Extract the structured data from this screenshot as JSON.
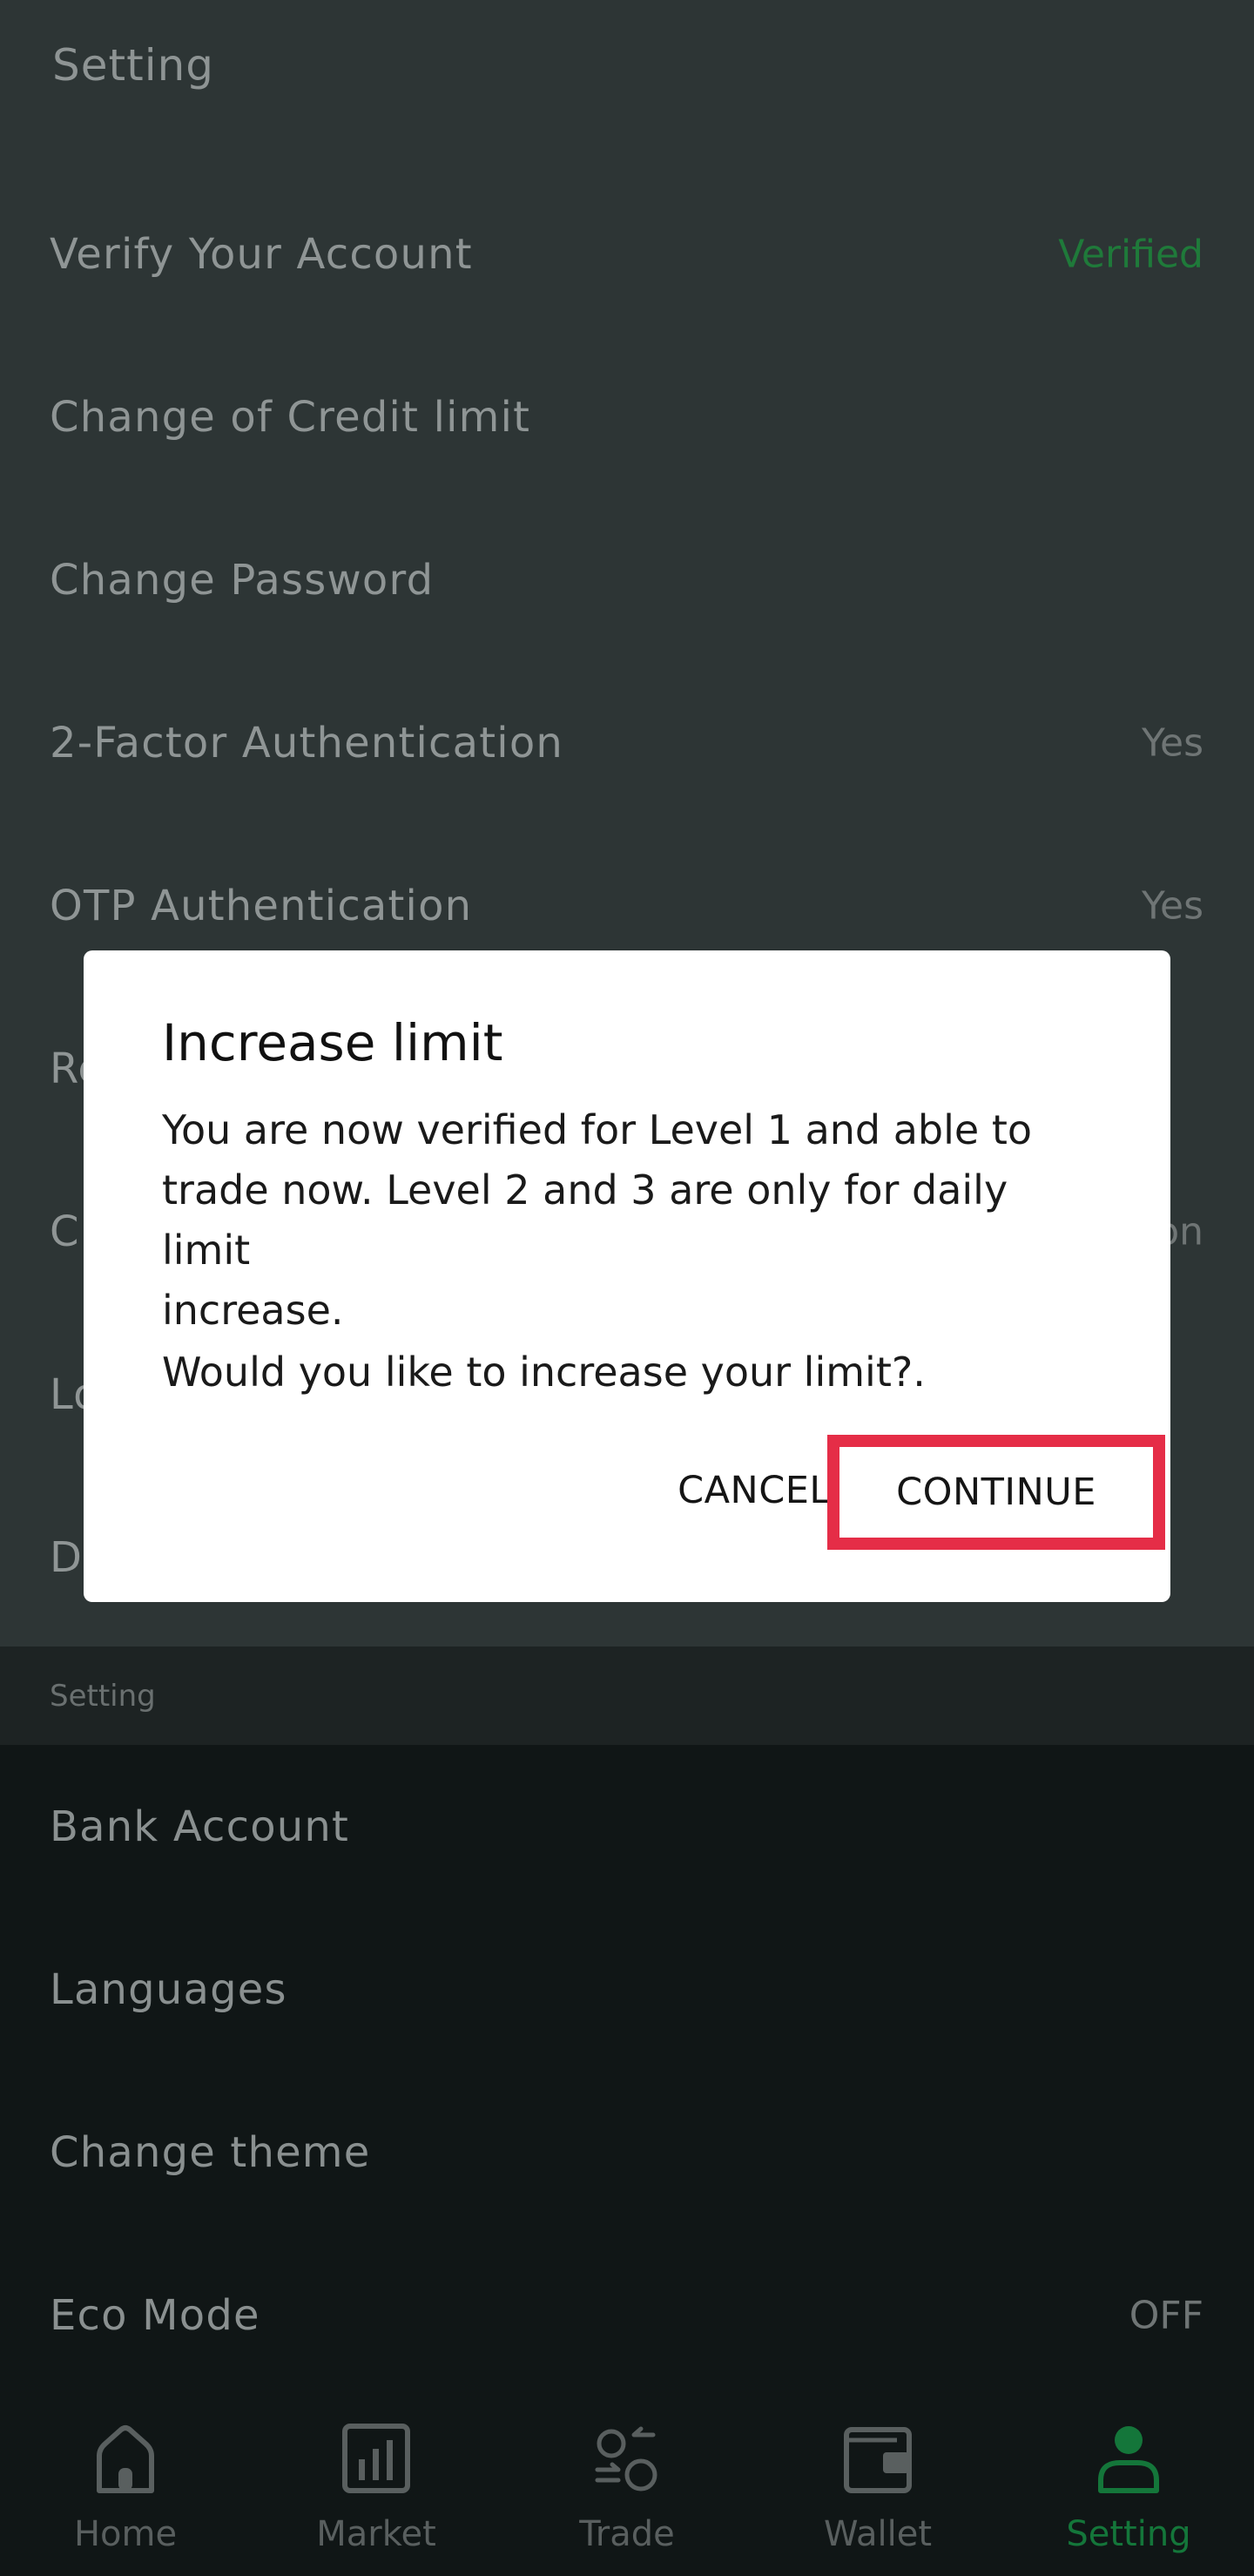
{
  "header": {
    "title": "Setting"
  },
  "settings_top": [
    {
      "label": "Verify Your Account",
      "value": "Verified"
    },
    {
      "label": "Change of Credit limit",
      "value": ""
    },
    {
      "label": "Change Password",
      "value": ""
    },
    {
      "label": "2-Factor Authentication",
      "value": "Yes"
    },
    {
      "label": "OTP Authentication",
      "value": "Yes"
    },
    {
      "label": "Re",
      "value": ""
    },
    {
      "label": "Ch",
      "value": "on"
    },
    {
      "label": "Lo",
      "value": ""
    },
    {
      "label": "De",
      "value": ""
    }
  ],
  "section": {
    "title": "Setting"
  },
  "settings_bottom": [
    {
      "label": "Bank Account",
      "value": ""
    },
    {
      "label": "Languages",
      "value": ""
    },
    {
      "label": "Change theme",
      "value": ""
    },
    {
      "label": "Eco Mode",
      "value": "OFF"
    }
  ],
  "dialog": {
    "title": "Increase limit",
    "body_line1": "You are now verified for Level 1 and able to",
    "body_line2": "trade now. Level 2 and 3 are only for daily limit",
    "body_line3": "increase.",
    "question": "Would you like to increase your limit?.",
    "cancel": "CANCEL",
    "continue": "CONTINUE"
  },
  "tabs": [
    {
      "label": "Home",
      "icon": "home-icon"
    },
    {
      "label": "Market",
      "icon": "market-icon"
    },
    {
      "label": "Trade",
      "icon": "trade-icon"
    },
    {
      "label": "Wallet",
      "icon": "wallet-icon"
    },
    {
      "label": "Setting",
      "icon": "person-icon",
      "active": true
    }
  ],
  "colors": {
    "overlay_bg": "#2d3535",
    "accent_green": "#14763a",
    "highlight_red": "#e52d47"
  }
}
